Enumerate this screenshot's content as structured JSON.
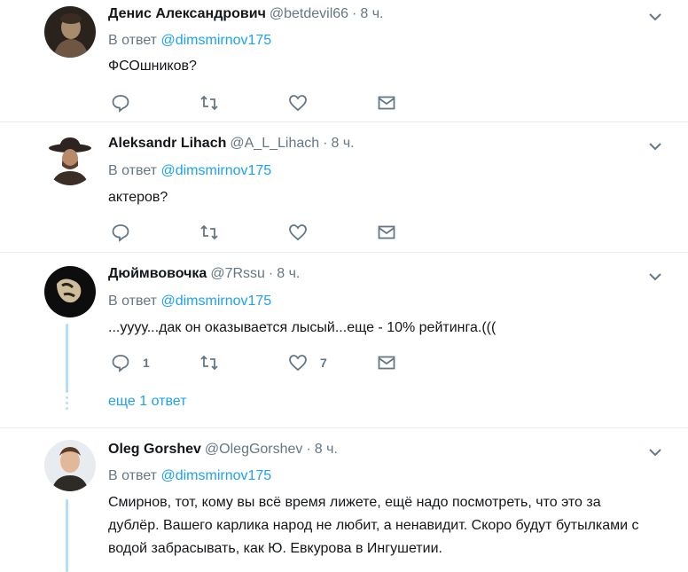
{
  "tweets": [
    {
      "name": "Денис Александрович",
      "handle": "@betdevil66",
      "time": "8 ч.",
      "reply_prefix": "В ответ",
      "reply_to": "@dimsmirnov175",
      "text": "ФСОшников?",
      "replies": "",
      "likes": ""
    },
    {
      "name": "Aleksandr Lihach",
      "handle": "@A_L_Lihach",
      "time": "8 ч.",
      "reply_prefix": "В ответ",
      "reply_to": "@dimsmirnov175",
      "text": "актеров?",
      "replies": "",
      "likes": ""
    },
    {
      "name": "Дюймвовочка",
      "handle": "@7Rssu",
      "time": "8 ч.",
      "reply_prefix": "В ответ",
      "reply_to": "@dimsmirnov175",
      "text": "...уууу...дак он оказывается лысый...еще - 10% рейтинга.(((",
      "replies": "1",
      "likes": "7",
      "more_replies": "еще 1 ответ"
    },
    {
      "name": "Oleg Gorshev",
      "handle": "@OlegGorshev",
      "time": "8 ч.",
      "reply_prefix": "В ответ",
      "reply_to": "@dimsmirnov175",
      "text": "Смирнов, тот, кому вы всё время лижете, ещё надо посмотреть, что это за дублёр. Вашего карлика народ не любит, а ненавидит. Скоро будут бутылками с водой забрасывать, как Ю. Евкурова в Ингушетии."
    }
  ],
  "dot": "·",
  "colors": {
    "link": "#1da1f2",
    "muted": "#657786",
    "thread": "#b3e0f8"
  }
}
